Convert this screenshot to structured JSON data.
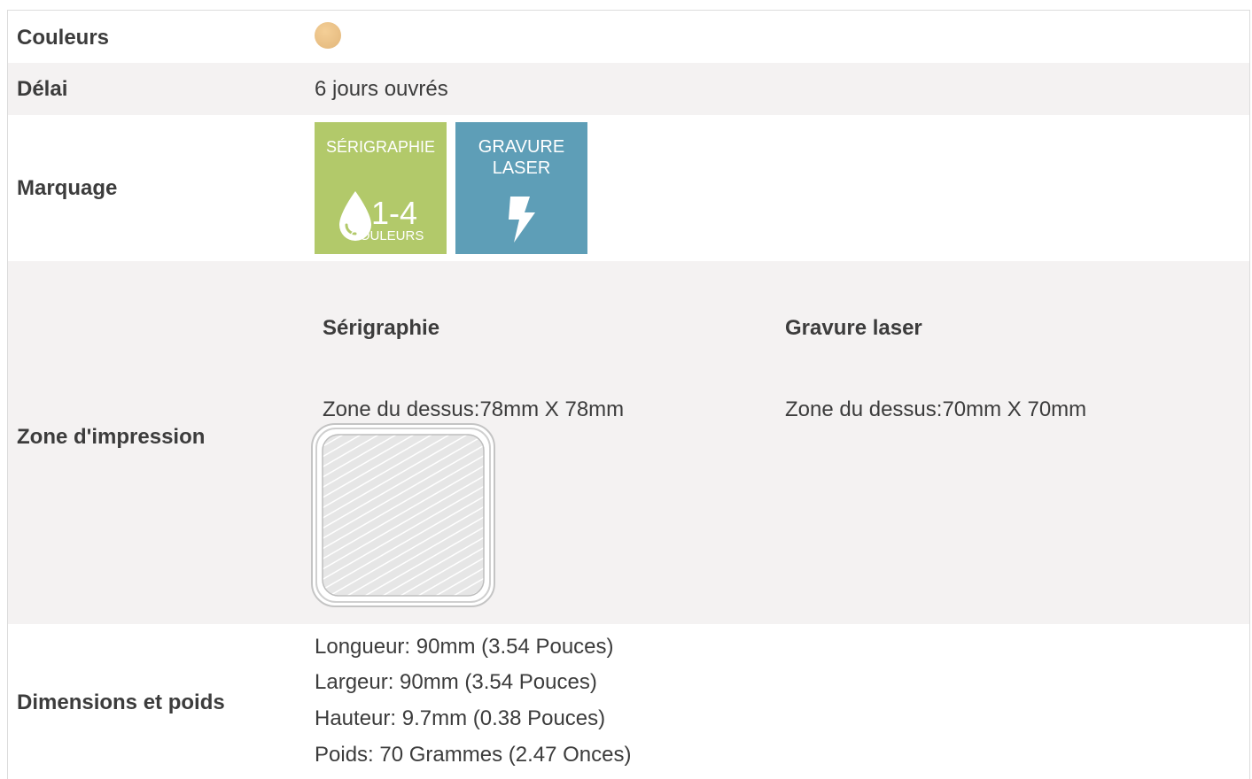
{
  "rows": {
    "couleurs": {
      "label": "Couleurs",
      "swatch_color": "#ecc38a"
    },
    "delai": {
      "label": "Délai",
      "value": "6 jours ouvrés"
    },
    "marquage": {
      "label": "Marquage",
      "badges": [
        {
          "title": "SÉRIGRAPHIE",
          "number": "1-4",
          "sub": "COULEURS",
          "color": "#b2c96a",
          "icon": "ink-drop-icon"
        },
        {
          "title_line1": "GRAVURE",
          "title_line2": "LASER",
          "color": "#5e9eb7",
          "icon": "lightning-bolt-icon"
        }
      ]
    },
    "zone": {
      "label": "Zone d'impression",
      "serigraphie_title": "Sérigraphie",
      "serigraphie_text": "Zone du dessus:78mm X 78mm",
      "laser_title": "Gravure laser",
      "laser_text": "Zone du dessus:70mm X 70mm"
    },
    "dimensions": {
      "label": "Dimensions et poids",
      "lines": [
        "Longueur: 90mm (3.54 Pouces)",
        "Largeur: 90mm (3.54 Pouces)",
        "Hauteur: 9.7mm (0.38 Pouces)",
        "Poids: 70 Grammes (2.47 Onces)"
      ]
    }
  }
}
